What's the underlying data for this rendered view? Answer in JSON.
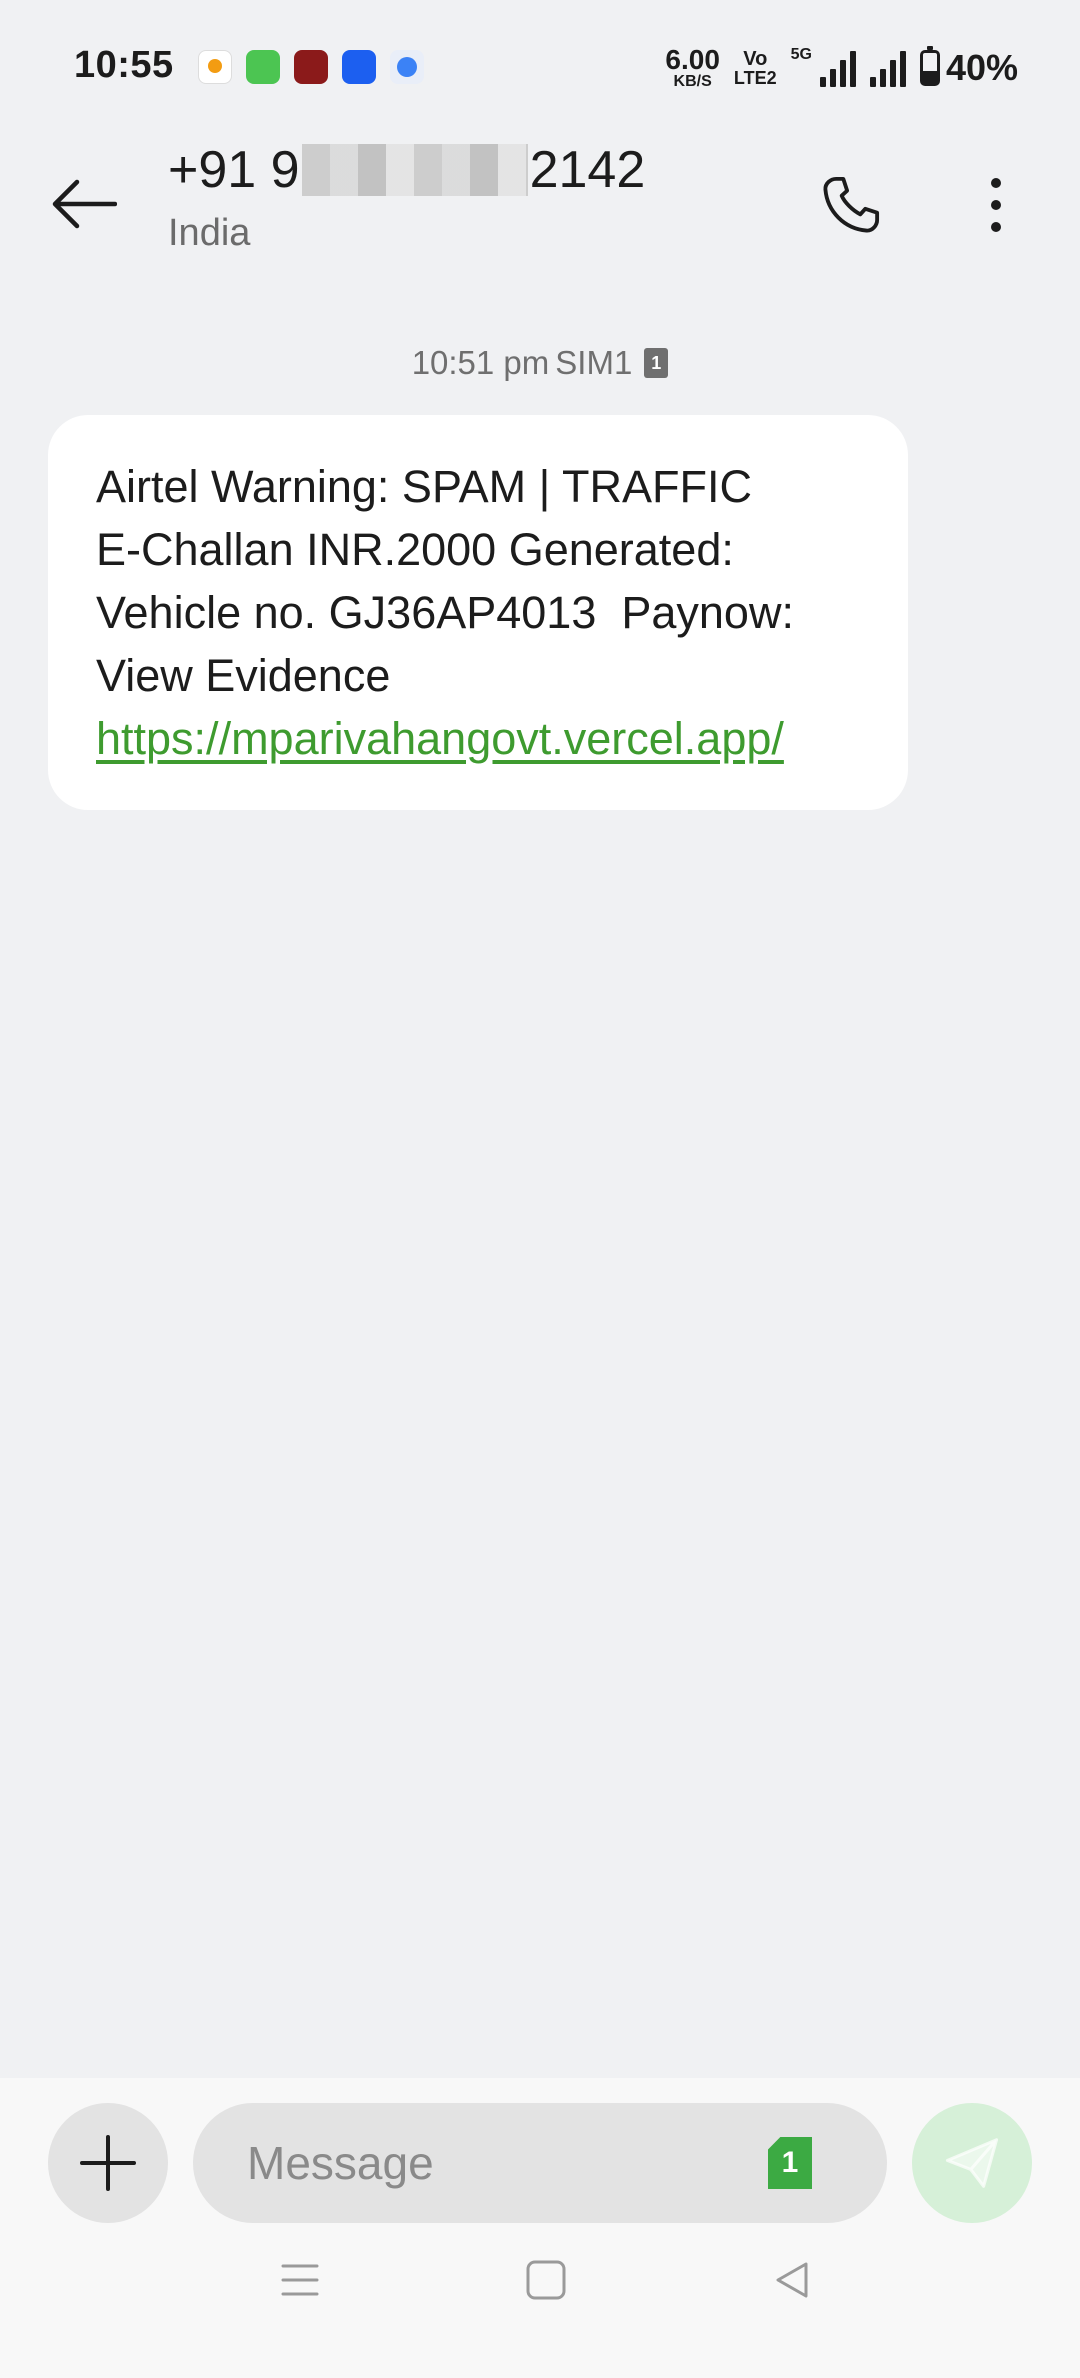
{
  "status_bar": {
    "time": "10:55",
    "net_speed_value": "6.00",
    "net_speed_unit": "KB/S",
    "volte_top": "Vo",
    "volte_bottom": "LTE2",
    "network_type": "5G",
    "battery_text": "40%",
    "battery_level": 0.4,
    "notification_icons": [
      "app-icon-1",
      "app-icon-2",
      "app-icon-3",
      "phone-app-icon",
      "browser-app-icon"
    ]
  },
  "header": {
    "number_prefix": "+91 9",
    "number_suffix": "2142",
    "location": "India",
    "icons": {
      "back": "back-arrow-icon",
      "call": "phone-icon",
      "more": "more-vertical-icon"
    }
  },
  "conversation": {
    "timestamp": "10:51 pm",
    "sim_label": "SIM1",
    "sim_number": "1",
    "message": {
      "text_line1": "Airtel Warning: SPAM | TRAFFIC",
      "text_line2": "E-Challan INR.2000 Generated:",
      "text_line3": "Vehicle no. GJ36AP4013  Paynow:",
      "text_line4": "View Evidence",
      "link": "https://mparivahangovt.vercel.app/"
    }
  },
  "composer": {
    "placeholder": "Message",
    "sim_number": "1",
    "accent_color": "#3caa43"
  }
}
